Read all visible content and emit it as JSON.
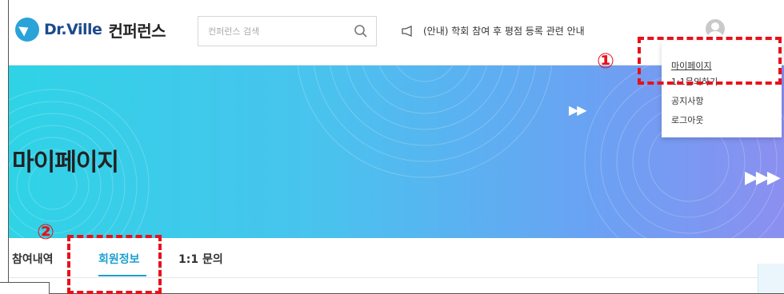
{
  "header": {
    "logo_text": "Dr.Ville",
    "logo_sub": "컨퍼런스",
    "search_placeholder": "컨퍼런스 검색",
    "notice": "(안내) 학회 참여 후 평점 등록 관련 안내"
  },
  "hero": {
    "title": "마이페이지",
    "arrows_small": "▶▶",
    "arrows_large": "▶▶▶"
  },
  "dropdown": {
    "items": [
      "마이페이지",
      "1:1문의하기",
      "공지사항",
      "로그아웃"
    ]
  },
  "tabs": {
    "items": [
      "참여내역",
      "회원정보",
      "1:1 문의"
    ],
    "active": "회원정보"
  },
  "annotations": {
    "one": "①",
    "two": "②"
  },
  "colors": {
    "accent": "#1a9fd0",
    "annotation": "#e8111b",
    "logo_blue": "#1c4b8c"
  }
}
